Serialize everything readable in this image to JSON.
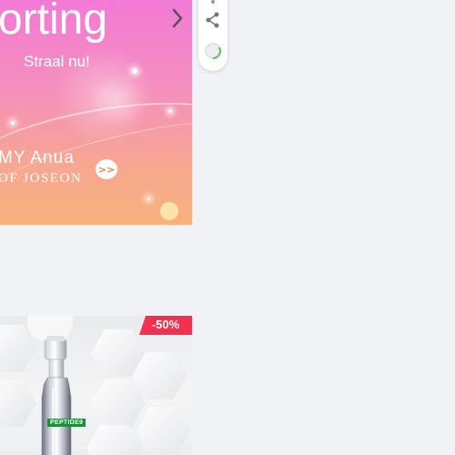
{
  "banner": {
    "heading": "orting",
    "subheading": "Straal nu!",
    "brand_line1": "MY   Anua",
    "brand_line2": "OF JOSEON",
    "arrow_label": ">>"
  },
  "product": {
    "discount_badge": "-50%",
    "brand_label": "PEPTIDE9"
  },
  "icons": {
    "carousel_next": "chevron-right-icon",
    "share": "share-icon",
    "loading": "loading-spinner-icon"
  },
  "colors": {
    "page_background": "#f0f2f6",
    "banner_gradient_top": "#f27ad6",
    "banner_gradient_bottom": "#f8b27b",
    "discount_badge": "#f23050",
    "loader_accent": "#5ac05a"
  }
}
